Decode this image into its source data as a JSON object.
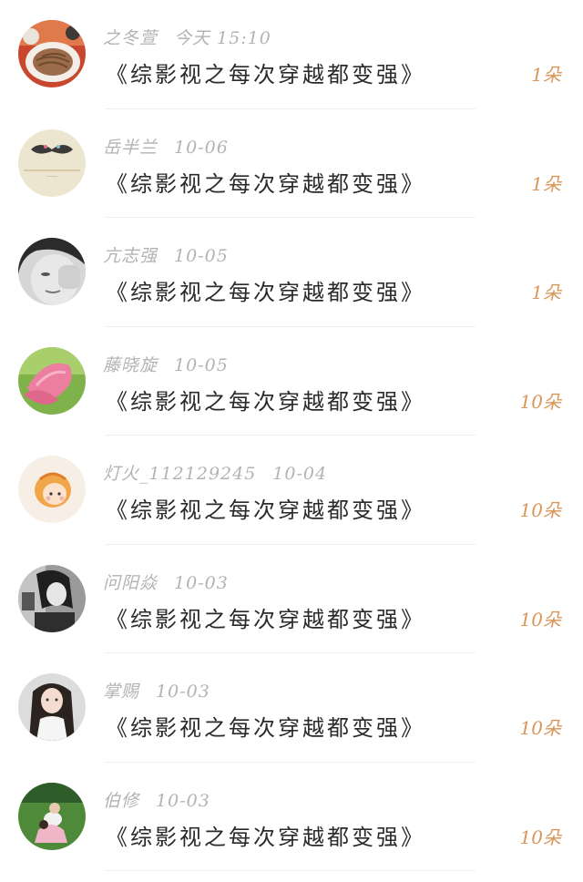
{
  "items": [
    {
      "name": "之冬萱",
      "date": "今天 15:10",
      "title": "《综影视之每次穿越都变强》",
      "count": "1朵",
      "avatar_icon": "food-plate-avatar"
    },
    {
      "name": "岳半兰",
      "date": "10-06",
      "title": "《综影视之每次穿越都变强》",
      "count": "1朵",
      "avatar_icon": "mustache-avatar"
    },
    {
      "name": "亢志强",
      "date": "10-05",
      "title": "《综影视之每次穿越都变强》",
      "count": "1朵",
      "avatar_icon": "bw-face-avatar"
    },
    {
      "name": "藤晓旋",
      "date": "10-05",
      "title": "《综影视之每次穿越都变强》",
      "count": "10朵",
      "avatar_icon": "lotus-avatar"
    },
    {
      "name": "灯火_112129245",
      "date": "10-04",
      "title": "《综影视之每次穿越都变强》",
      "count": "10朵",
      "avatar_icon": "cartoon-girl-avatar"
    },
    {
      "name": "问阳焱",
      "date": "10-03",
      "title": "《综影视之每次穿越都变强》",
      "count": "10朵",
      "avatar_icon": "bw-person-avatar"
    },
    {
      "name": "掌赐",
      "date": "10-03",
      "title": "《综影视之每次穿越都变强》",
      "count": "10朵",
      "avatar_icon": "girl-photo-avatar"
    },
    {
      "name": "伯修",
      "date": "10-03",
      "title": "《综影视之每次穿越都变强》",
      "count": "10朵",
      "avatar_icon": "couple-grass-avatar"
    }
  ],
  "colors": {
    "count": "#d9975a",
    "meta": "#b3b3b3",
    "title": "#2a2a2a",
    "divider": "#efefef"
  }
}
